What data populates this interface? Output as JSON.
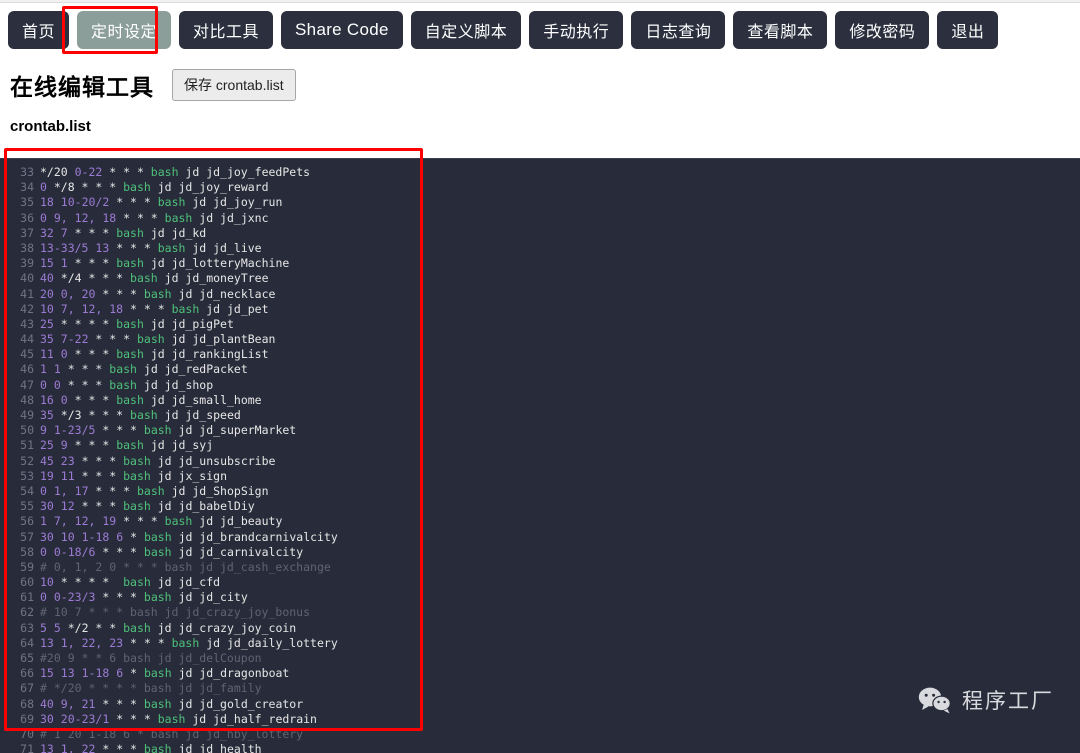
{
  "nav": {
    "items": [
      {
        "label": "首页",
        "name": "nav-home",
        "active": false,
        "latin": false
      },
      {
        "label": "定时设定",
        "name": "nav-schedule",
        "active": true,
        "latin": false
      },
      {
        "label": "对比工具",
        "name": "nav-compare-tool",
        "active": false,
        "latin": false
      },
      {
        "label": "Share Code",
        "name": "nav-share-code",
        "active": false,
        "latin": true
      },
      {
        "label": "自定义脚本",
        "name": "nav-custom-script",
        "active": false,
        "latin": false
      },
      {
        "label": "手动执行",
        "name": "nav-manual-run",
        "active": false,
        "latin": false
      },
      {
        "label": "日志查询",
        "name": "nav-log-query",
        "active": false,
        "latin": false
      },
      {
        "label": "查看脚本",
        "name": "nav-view-script",
        "active": false,
        "latin": false
      },
      {
        "label": "修改密码",
        "name": "nav-change-password",
        "active": false,
        "latin": false
      },
      {
        "label": "退出",
        "name": "nav-logout",
        "active": false,
        "latin": false
      }
    ],
    "active_highlight_color": "#ff0000",
    "button_bg": "#2b2f3e",
    "active_button_bg": "#8b9e9a"
  },
  "header": {
    "title": "在线编辑工具",
    "save_button_label": "保存 crontab.list"
  },
  "file": {
    "name": "crontab.list"
  },
  "editor": {
    "background": "#282c3a",
    "line_number_color": "#6f7585",
    "plain_color": "#e6e6e6",
    "number_color": "#9c7bd4",
    "command_color": "#4ec07a",
    "comment_color": "#5e6472",
    "highlight_box_color": "#ff0000",
    "first_visible_line": 33,
    "last_visible_line": 71,
    "lines": [
      {
        "n": 33,
        "comment": false,
        "tokens": [
          [
            "plain",
            "*/20 "
          ],
          [
            "num",
            "0-22"
          ],
          [
            "plain",
            " * * * "
          ],
          [
            "cmd",
            "bash"
          ],
          [
            "plain",
            " jd jd_joy_feedPets"
          ]
        ]
      },
      {
        "n": 34,
        "comment": false,
        "tokens": [
          [
            "num",
            "0"
          ],
          [
            "plain",
            " */8 * * * "
          ],
          [
            "cmd",
            "bash"
          ],
          [
            "plain",
            " jd jd_joy_reward"
          ]
        ]
      },
      {
        "n": 35,
        "comment": false,
        "tokens": [
          [
            "num",
            "18"
          ],
          [
            "plain",
            " "
          ],
          [
            "num",
            "10-20/2"
          ],
          [
            "plain",
            " * * * "
          ],
          [
            "cmd",
            "bash"
          ],
          [
            "plain",
            " jd jd_joy_run"
          ]
        ]
      },
      {
        "n": 36,
        "comment": false,
        "tokens": [
          [
            "num",
            "0"
          ],
          [
            "plain",
            " "
          ],
          [
            "num",
            "9, 12, 18"
          ],
          [
            "plain",
            " * * * "
          ],
          [
            "cmd",
            "bash"
          ],
          [
            "plain",
            " jd jd_jxnc"
          ]
        ]
      },
      {
        "n": 37,
        "comment": false,
        "tokens": [
          [
            "num",
            "32"
          ],
          [
            "plain",
            " "
          ],
          [
            "num",
            "7"
          ],
          [
            "plain",
            " * * * "
          ],
          [
            "cmd",
            "bash"
          ],
          [
            "plain",
            " jd jd_kd"
          ]
        ]
      },
      {
        "n": 38,
        "comment": false,
        "tokens": [
          [
            "num",
            "13-33/5"
          ],
          [
            "plain",
            " "
          ],
          [
            "num",
            "13"
          ],
          [
            "plain",
            " * * * "
          ],
          [
            "cmd",
            "bash"
          ],
          [
            "plain",
            " jd jd_live"
          ]
        ]
      },
      {
        "n": 39,
        "comment": false,
        "tokens": [
          [
            "num",
            "15"
          ],
          [
            "plain",
            " "
          ],
          [
            "num",
            "1"
          ],
          [
            "plain",
            " * * * "
          ],
          [
            "cmd",
            "bash"
          ],
          [
            "plain",
            " jd jd_lotteryMachine"
          ]
        ]
      },
      {
        "n": 40,
        "comment": false,
        "tokens": [
          [
            "num",
            "40"
          ],
          [
            "plain",
            " */4 * * * "
          ],
          [
            "cmd",
            "bash"
          ],
          [
            "plain",
            " jd jd_moneyTree"
          ]
        ]
      },
      {
        "n": 41,
        "comment": false,
        "tokens": [
          [
            "num",
            "20"
          ],
          [
            "plain",
            " "
          ],
          [
            "num",
            "0, 20"
          ],
          [
            "plain",
            " * * * "
          ],
          [
            "cmd",
            "bash"
          ],
          [
            "plain",
            " jd jd_necklace"
          ]
        ]
      },
      {
        "n": 42,
        "comment": false,
        "tokens": [
          [
            "num",
            "10"
          ],
          [
            "plain",
            " "
          ],
          [
            "num",
            "7, 12, 18"
          ],
          [
            "plain",
            " * * * "
          ],
          [
            "cmd",
            "bash"
          ],
          [
            "plain",
            " jd jd_pet"
          ]
        ]
      },
      {
        "n": 43,
        "comment": false,
        "tokens": [
          [
            "num",
            "25"
          ],
          [
            "plain",
            " * * * * "
          ],
          [
            "cmd",
            "bash"
          ],
          [
            "plain",
            " jd jd_pigPet"
          ]
        ]
      },
      {
        "n": 44,
        "comment": false,
        "tokens": [
          [
            "num",
            "35"
          ],
          [
            "plain",
            " "
          ],
          [
            "num",
            "7-22"
          ],
          [
            "plain",
            " * * * "
          ],
          [
            "cmd",
            "bash"
          ],
          [
            "plain",
            " jd jd_plantBean"
          ]
        ]
      },
      {
        "n": 45,
        "comment": false,
        "tokens": [
          [
            "num",
            "11"
          ],
          [
            "plain",
            " "
          ],
          [
            "num",
            "0"
          ],
          [
            "plain",
            " * * * "
          ],
          [
            "cmd",
            "bash"
          ],
          [
            "plain",
            " jd jd_rankingList"
          ]
        ]
      },
      {
        "n": 46,
        "comment": false,
        "tokens": [
          [
            "num",
            "1"
          ],
          [
            "plain",
            " "
          ],
          [
            "num",
            "1"
          ],
          [
            "plain",
            " * * * "
          ],
          [
            "cmd",
            "bash"
          ],
          [
            "plain",
            " jd jd_redPacket"
          ]
        ]
      },
      {
        "n": 47,
        "comment": false,
        "tokens": [
          [
            "num",
            "0"
          ],
          [
            "plain",
            " "
          ],
          [
            "num",
            "0"
          ],
          [
            "plain",
            " * * * "
          ],
          [
            "cmd",
            "bash"
          ],
          [
            "plain",
            " jd jd_shop"
          ]
        ]
      },
      {
        "n": 48,
        "comment": false,
        "tokens": [
          [
            "num",
            "16"
          ],
          [
            "plain",
            " "
          ],
          [
            "num",
            "0"
          ],
          [
            "plain",
            " * * * "
          ],
          [
            "cmd",
            "bash"
          ],
          [
            "plain",
            " jd jd_small_home"
          ]
        ]
      },
      {
        "n": 49,
        "comment": false,
        "tokens": [
          [
            "num",
            "35"
          ],
          [
            "plain",
            " */3 * * * "
          ],
          [
            "cmd",
            "bash"
          ],
          [
            "plain",
            " jd jd_speed"
          ]
        ]
      },
      {
        "n": 50,
        "comment": false,
        "tokens": [
          [
            "num",
            "9"
          ],
          [
            "plain",
            " "
          ],
          [
            "num",
            "1-23/5"
          ],
          [
            "plain",
            " * * * "
          ],
          [
            "cmd",
            "bash"
          ],
          [
            "plain",
            " jd jd_superMarket"
          ]
        ]
      },
      {
        "n": 51,
        "comment": false,
        "tokens": [
          [
            "num",
            "25"
          ],
          [
            "plain",
            " "
          ],
          [
            "num",
            "9"
          ],
          [
            "plain",
            " * * * "
          ],
          [
            "cmd",
            "bash"
          ],
          [
            "plain",
            " jd jd_syj"
          ]
        ]
      },
      {
        "n": 52,
        "comment": false,
        "tokens": [
          [
            "num",
            "45"
          ],
          [
            "plain",
            " "
          ],
          [
            "num",
            "23"
          ],
          [
            "plain",
            " * * * "
          ],
          [
            "cmd",
            "bash"
          ],
          [
            "plain",
            " jd jd_unsubscribe"
          ]
        ]
      },
      {
        "n": 53,
        "comment": false,
        "tokens": [
          [
            "num",
            "19"
          ],
          [
            "plain",
            " "
          ],
          [
            "num",
            "11"
          ],
          [
            "plain",
            " * * * "
          ],
          [
            "cmd",
            "bash"
          ],
          [
            "plain",
            " jd jx_sign"
          ]
        ]
      },
      {
        "n": 54,
        "comment": false,
        "tokens": [
          [
            "num",
            "0"
          ],
          [
            "plain",
            " "
          ],
          [
            "num",
            "1, 17"
          ],
          [
            "plain",
            " * * * "
          ],
          [
            "cmd",
            "bash"
          ],
          [
            "plain",
            " jd jd_ShopSign"
          ]
        ]
      },
      {
        "n": 55,
        "comment": false,
        "tokens": [
          [
            "num",
            "30"
          ],
          [
            "plain",
            " "
          ],
          [
            "num",
            "12"
          ],
          [
            "plain",
            " * * * "
          ],
          [
            "cmd",
            "bash"
          ],
          [
            "plain",
            " jd jd_babelDiy"
          ]
        ]
      },
      {
        "n": 56,
        "comment": false,
        "tokens": [
          [
            "num",
            "1"
          ],
          [
            "plain",
            " "
          ],
          [
            "num",
            "7, 12, 19"
          ],
          [
            "plain",
            " * * * "
          ],
          [
            "cmd",
            "bash"
          ],
          [
            "plain",
            " jd jd_beauty"
          ]
        ]
      },
      {
        "n": 57,
        "comment": false,
        "tokens": [
          [
            "num",
            "30"
          ],
          [
            "plain",
            " "
          ],
          [
            "num",
            "10"
          ],
          [
            "plain",
            " "
          ],
          [
            "num",
            "1-18"
          ],
          [
            "plain",
            " "
          ],
          [
            "num",
            "6"
          ],
          [
            "plain",
            " * "
          ],
          [
            "cmd",
            "bash"
          ],
          [
            "plain",
            " jd jd_brandcarnivalcity"
          ]
        ]
      },
      {
        "n": 58,
        "comment": false,
        "tokens": [
          [
            "num",
            "0"
          ],
          [
            "plain",
            " "
          ],
          [
            "num",
            "0-18/6"
          ],
          [
            "plain",
            " * * * "
          ],
          [
            "cmd",
            "bash"
          ],
          [
            "plain",
            " jd jd_carnivalcity"
          ]
        ]
      },
      {
        "n": 59,
        "comment": true,
        "tokens": [
          [
            "comment",
            "# 0, 1, 2 0 * * * bash jd jd_cash_exchange"
          ]
        ]
      },
      {
        "n": 60,
        "comment": false,
        "tokens": [
          [
            "num",
            "10"
          ],
          [
            "plain",
            " * * * *  "
          ],
          [
            "cmd",
            "bash"
          ],
          [
            "plain",
            " jd jd_cfd"
          ]
        ]
      },
      {
        "n": 61,
        "comment": false,
        "tokens": [
          [
            "num",
            "0"
          ],
          [
            "plain",
            " "
          ],
          [
            "num",
            "0-23/3"
          ],
          [
            "plain",
            " * * * "
          ],
          [
            "cmd",
            "bash"
          ],
          [
            "plain",
            " jd jd_city"
          ]
        ]
      },
      {
        "n": 62,
        "comment": true,
        "tokens": [
          [
            "comment",
            "# 10 7 * * * bash jd jd_crazy_joy_bonus"
          ]
        ]
      },
      {
        "n": 63,
        "comment": false,
        "tokens": [
          [
            "num",
            "5"
          ],
          [
            "plain",
            " "
          ],
          [
            "num",
            "5"
          ],
          [
            "plain",
            " */2 * * "
          ],
          [
            "cmd",
            "bash"
          ],
          [
            "plain",
            " jd jd_crazy_joy_coin"
          ]
        ]
      },
      {
        "n": 64,
        "comment": false,
        "tokens": [
          [
            "num",
            "13"
          ],
          [
            "plain",
            " "
          ],
          [
            "num",
            "1, 22, 23"
          ],
          [
            "plain",
            " * * * "
          ],
          [
            "cmd",
            "bash"
          ],
          [
            "plain",
            " jd jd_daily_lottery"
          ]
        ]
      },
      {
        "n": 65,
        "comment": true,
        "tokens": [
          [
            "comment",
            "#20 9 * * 6 bash jd jd_delCoupon"
          ]
        ]
      },
      {
        "n": 66,
        "comment": false,
        "tokens": [
          [
            "num",
            "15"
          ],
          [
            "plain",
            " "
          ],
          [
            "num",
            "13"
          ],
          [
            "plain",
            " "
          ],
          [
            "num",
            "1-18"
          ],
          [
            "plain",
            " "
          ],
          [
            "num",
            "6"
          ],
          [
            "plain",
            " * "
          ],
          [
            "cmd",
            "bash"
          ],
          [
            "plain",
            " jd jd_dragonboat"
          ]
        ]
      },
      {
        "n": 67,
        "comment": true,
        "tokens": [
          [
            "comment",
            "# */20 * * * * bash jd jd_family"
          ]
        ]
      },
      {
        "n": 68,
        "comment": false,
        "tokens": [
          [
            "num",
            "40"
          ],
          [
            "plain",
            " "
          ],
          [
            "num",
            "9, 21"
          ],
          [
            "plain",
            " * * * "
          ],
          [
            "cmd",
            "bash"
          ],
          [
            "plain",
            " jd jd_gold_creator"
          ]
        ]
      },
      {
        "n": 69,
        "comment": false,
        "tokens": [
          [
            "num",
            "30"
          ],
          [
            "plain",
            " "
          ],
          [
            "num",
            "20-23/1"
          ],
          [
            "plain",
            " * * * "
          ],
          [
            "cmd",
            "bash"
          ],
          [
            "plain",
            " jd jd_half_redrain"
          ]
        ]
      },
      {
        "n": 70,
        "comment": true,
        "tokens": [
          [
            "comment",
            "# 1 20 1-18 6 * bash jd jd_hby_lottery"
          ]
        ]
      },
      {
        "n": 71,
        "comment": false,
        "tokens": [
          [
            "num",
            "13"
          ],
          [
            "plain",
            " "
          ],
          [
            "num",
            "1, 22"
          ],
          [
            "plain",
            " * * * "
          ],
          [
            "cmd",
            "bash"
          ],
          [
            "plain",
            " jd jd_health"
          ]
        ]
      }
    ]
  },
  "watermark": {
    "text": "程序工厂",
    "icon": "wechat-icon"
  }
}
